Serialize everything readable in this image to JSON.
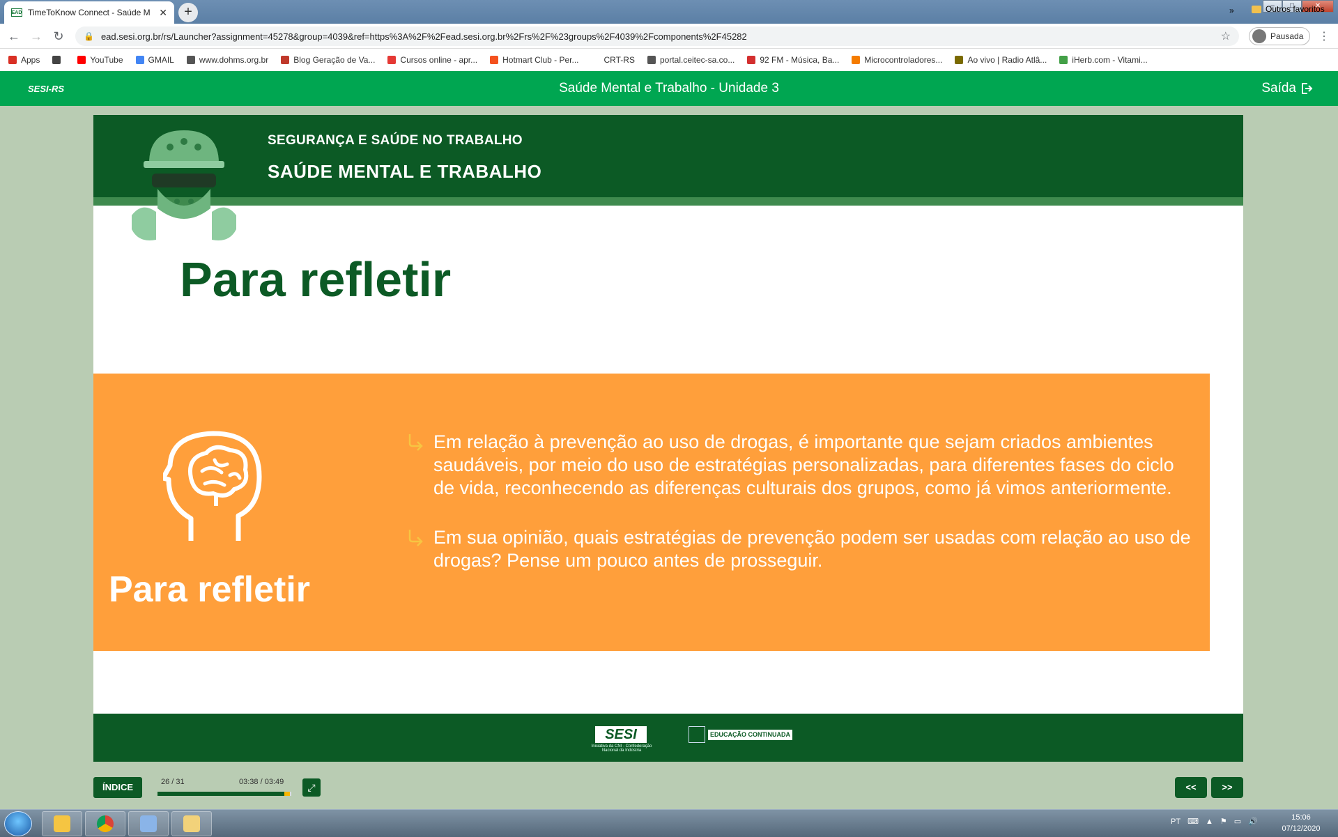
{
  "browser": {
    "tab_title": "TimeToKnow Connect - Saúde M",
    "tab_favicon": "EAD",
    "url": "ead.sesi.org.br/rs/Launcher?assignment=45278&group=4039&ref=https%3A%2F%2Fead.sesi.org.br%2Frs%2F%23groups%2F4039%2Fcomponents%2F45282",
    "profile_label": "Pausada",
    "bookmarks": [
      {
        "label": "Apps",
        "color": "#d93025"
      },
      {
        "label": "",
        "color": "#444444"
      },
      {
        "label": "YouTube",
        "color": "#ff0000"
      },
      {
        "label": "GMAIL",
        "color": "#4285f4"
      },
      {
        "label": "www.dohms.org.br",
        "color": "#555555"
      },
      {
        "label": "Blog Geração de Va...",
        "color": "#c0392b"
      },
      {
        "label": "Cursos online - apr...",
        "color": "#e53935"
      },
      {
        "label": "Hotmart Club - Per...",
        "color": "#f4511e"
      },
      {
        "label": "CRT-RS",
        "color": "#ffffff"
      },
      {
        "label": "portal.ceitec-sa.co...",
        "color": "#555555"
      },
      {
        "label": "92 FM - Música, Ba...",
        "color": "#d32f2f"
      },
      {
        "label": "Microcontroladores...",
        "color": "#f57c00"
      },
      {
        "label": "Ao vivo | Radio Atlâ...",
        "color": "#7a6a00"
      },
      {
        "label": "iHerb.com - Vitami...",
        "color": "#43a047"
      }
    ],
    "bookmarks_more": "»",
    "bookmarks_other": "Outros favoritos"
  },
  "app": {
    "logo": "SESI-RS",
    "title": "Saúde Mental e Trabalho - Unidade 3",
    "exit_label": "Saída"
  },
  "slide": {
    "header_subtitle": "SEGURANÇA E SAÚDE NO TRABALHO",
    "header_title": "SAÚDE MENTAL E TRABALHO",
    "page_title": "Para refletir",
    "box_label": "Para refletir",
    "bullets": [
      "Em relação à prevenção ao uso de drogas, é importante que sejam criados ambientes saudáveis, por meio do uso de estratégias personalizadas, para diferentes fases do ciclo de vida, reconhecendo as diferenças culturais dos grupos, como já vimos anteriormente.",
      "Em sua opinião, quais estratégias de prevenção podem ser usadas com relação ao uso de drogas? Pense um pouco antes de prosseguir."
    ],
    "footer_logo_text": "SESI",
    "footer_logo_tagline": "Iniciativa da CNI - Confederação Nacional da Indústria",
    "footer_edu_text": "EDUCAÇÃO CONTINUADA",
    "colors": {
      "dark_green": "#0c5a25",
      "orange": "#ff9f3b",
      "app_green": "#00a651"
    }
  },
  "player": {
    "index_label": "ÍNDICE",
    "pages": "26 / 31",
    "time": "03:38 / 03:49",
    "progress": 0.95,
    "prev_label": "<<",
    "next_label": ">>"
  },
  "taskbar": {
    "language": "PT",
    "time": "15:06",
    "date": "07/12/2020"
  }
}
